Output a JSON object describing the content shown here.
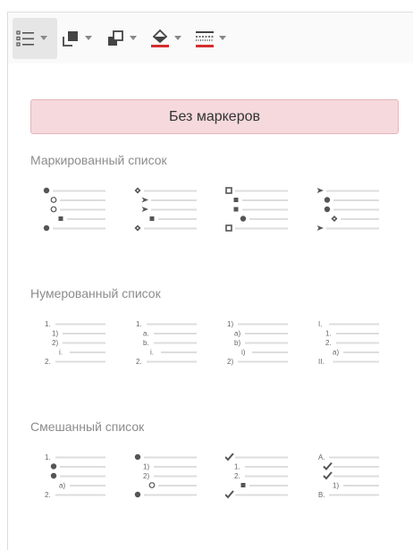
{
  "toolbar": {
    "buttons": [
      {
        "name": "bullet-list-icon",
        "active": true
      },
      {
        "name": "layer-back-icon",
        "active": false
      },
      {
        "name": "layer-front-icon",
        "active": false
      },
      {
        "name": "fill-color-icon",
        "active": false,
        "color": "#d32f2f"
      },
      {
        "name": "border-style-icon",
        "active": false,
        "color": "#d32f2f"
      }
    ]
  },
  "panel": {
    "no_bullets_label": "Без маркеров",
    "sections": [
      {
        "title": "Маркированный список",
        "items": [
          {
            "rows": [
              {
                "indent": 0,
                "marker": "dot"
              },
              {
                "indent": 1,
                "marker": "circle"
              },
              {
                "indent": 1,
                "marker": "circle"
              },
              {
                "indent": 2,
                "marker": "square"
              },
              {
                "indent": 0,
                "marker": "dot"
              }
            ]
          },
          {
            "rows": [
              {
                "indent": 0,
                "marker": "diamond"
              },
              {
                "indent": 1,
                "marker": "arrow"
              },
              {
                "indent": 1,
                "marker": "arrow"
              },
              {
                "indent": 2,
                "marker": "square"
              },
              {
                "indent": 0,
                "marker": "diamond"
              }
            ]
          },
          {
            "rows": [
              {
                "indent": 0,
                "marker": "hollow-square"
              },
              {
                "indent": 1,
                "marker": "square"
              },
              {
                "indent": 1,
                "marker": "square"
              },
              {
                "indent": 2,
                "marker": "dot"
              },
              {
                "indent": 0,
                "marker": "hollow-square"
              }
            ]
          },
          {
            "rows": [
              {
                "indent": 0,
                "marker": "arrow"
              },
              {
                "indent": 1,
                "marker": "dot"
              },
              {
                "indent": 1,
                "marker": "dot"
              },
              {
                "indent": 2,
                "marker": "diamond"
              },
              {
                "indent": 0,
                "marker": "arrow"
              }
            ]
          }
        ]
      },
      {
        "title": "Нумерованный список",
        "items": [
          {
            "rows": [
              {
                "indent": 0,
                "text": "1."
              },
              {
                "indent": 1,
                "text": "1)"
              },
              {
                "indent": 1,
                "text": "2)"
              },
              {
                "indent": 2,
                "text": "i."
              },
              {
                "indent": 0,
                "text": "2."
              }
            ]
          },
          {
            "rows": [
              {
                "indent": 0,
                "text": "1."
              },
              {
                "indent": 1,
                "text": "a."
              },
              {
                "indent": 1,
                "text": "b."
              },
              {
                "indent": 2,
                "text": "i."
              },
              {
                "indent": 0,
                "text": "2."
              }
            ]
          },
          {
            "rows": [
              {
                "indent": 0,
                "text": "1)"
              },
              {
                "indent": 1,
                "text": "a)"
              },
              {
                "indent": 1,
                "text": "b)"
              },
              {
                "indent": 2,
                "text": "i)"
              },
              {
                "indent": 0,
                "text": "2)"
              }
            ]
          },
          {
            "rows": [
              {
                "indent": 0,
                "text": "I."
              },
              {
                "indent": 1,
                "text": "1."
              },
              {
                "indent": 1,
                "text": "2."
              },
              {
                "indent": 2,
                "text": "a)"
              },
              {
                "indent": 0,
                "text": "II."
              }
            ]
          }
        ]
      },
      {
        "title": "Смешанный список",
        "items": [
          {
            "rows": [
              {
                "indent": 0,
                "text": "1."
              },
              {
                "indent": 1,
                "marker": "dot"
              },
              {
                "indent": 1,
                "marker": "dot"
              },
              {
                "indent": 2,
                "text": "a)"
              },
              {
                "indent": 0,
                "text": "2."
              }
            ]
          },
          {
            "rows": [
              {
                "indent": 0,
                "marker": "dot"
              },
              {
                "indent": 1,
                "text": "1)"
              },
              {
                "indent": 1,
                "text": "2)"
              },
              {
                "indent": 2,
                "marker": "circle"
              },
              {
                "indent": 0,
                "marker": "dot"
              }
            ]
          },
          {
            "rows": [
              {
                "indent": 0,
                "marker": "check"
              },
              {
                "indent": 1,
                "text": "1."
              },
              {
                "indent": 1,
                "text": "2."
              },
              {
                "indent": 2,
                "marker": "square"
              },
              {
                "indent": 0,
                "marker": "check"
              }
            ]
          },
          {
            "rows": [
              {
                "indent": 0,
                "text": "A."
              },
              {
                "indent": 1,
                "marker": "check"
              },
              {
                "indent": 1,
                "marker": "check"
              },
              {
                "indent": 2,
                "text": "1)"
              },
              {
                "indent": 0,
                "text": "B."
              }
            ]
          }
        ]
      }
    ]
  }
}
